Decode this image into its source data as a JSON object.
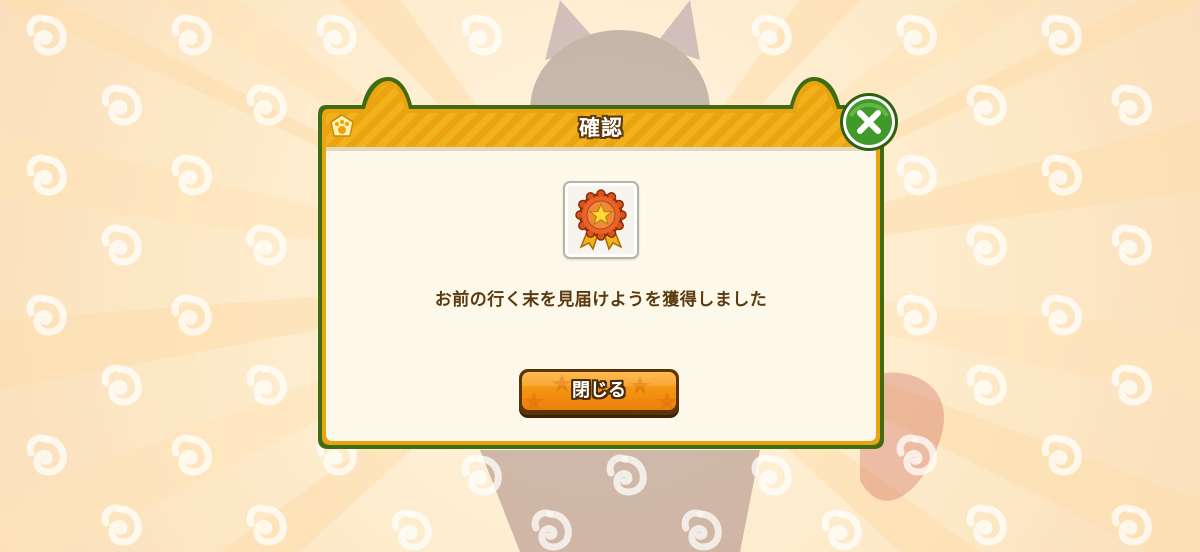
{
  "dialog": {
    "title": "確認",
    "message": "お前の行く末を見届けようを獲得しました",
    "close_label": "閉じる"
  },
  "icons": {
    "header_emblem": "paw-emblem-icon",
    "item": "star-medal-ribbon-icon",
    "dismiss": "close-x-icon"
  },
  "colors": {
    "header_gold": "#f2b21c",
    "panel_bg": "#fdf9ea",
    "panel_border": "#3f6b12",
    "button_orange": "#f49614",
    "x_button_green": "#3f9a2a",
    "text_brown": "#5b3a10"
  }
}
